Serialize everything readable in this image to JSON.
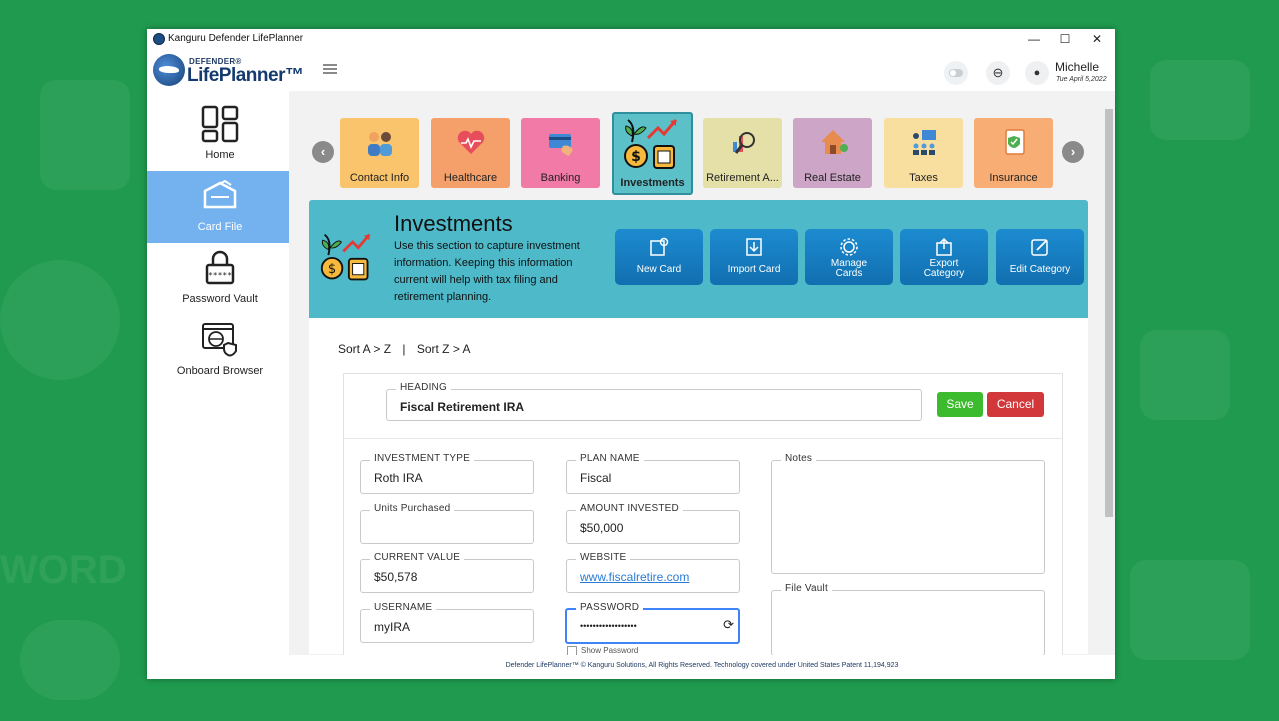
{
  "window": {
    "title": "Kanguru Defender LifePlanner",
    "controls": {
      "minimize": "—",
      "maximize": "☐",
      "close": "✕"
    }
  },
  "brand": {
    "top": "DEFENDER®",
    "main": "LifePlanner™"
  },
  "user": {
    "name": "Michelle",
    "date": "Tue April 5,2022"
  },
  "sidebar": {
    "items": [
      {
        "label": "Home",
        "icon": "grid-icon",
        "active": false
      },
      {
        "label": "Card File",
        "icon": "card-file-icon",
        "active": true
      },
      {
        "label": "Password Vault",
        "icon": "lock-icon",
        "active": false
      },
      {
        "label": "Onboard Browser",
        "icon": "browser-shield-icon",
        "active": false
      }
    ]
  },
  "categories": [
    {
      "label": "Contact Info",
      "color": "#f9c46b"
    },
    {
      "label": "Healthcare",
      "color": "#f5a06a"
    },
    {
      "label": "Banking",
      "color": "#f27aa6"
    },
    {
      "label": "Investments",
      "color": "#5bc0c7"
    },
    {
      "label": "Retirement A...",
      "color": "#e4e0a8"
    },
    {
      "label": "Real Estate",
      "color": "#cda5c6"
    },
    {
      "label": "Taxes",
      "color": "#f8df9f"
    },
    {
      "label": "Insurance",
      "color": "#f7ad74"
    }
  ],
  "section": {
    "title": "Investments",
    "description": "Use this section to capture investment information. Keeping this information current will help with tax filing and retirement planning."
  },
  "actions": [
    {
      "label": "New Card",
      "icon": "new-card-icon"
    },
    {
      "label": "Import Card",
      "icon": "import-icon"
    },
    {
      "label": "Manage Cards",
      "icon": "gear-icon"
    },
    {
      "label": "Export Category",
      "icon": "export-icon"
    },
    {
      "label": "Edit Category",
      "icon": "edit-icon"
    }
  ],
  "sort": {
    "az": "Sort A > Z",
    "sep": "|",
    "za": "Sort Z > A"
  },
  "form": {
    "heading_label": "HEADING",
    "heading_value": "Fiscal Retirement IRA",
    "save": "Save",
    "cancel": "Cancel",
    "investment_type_label": "INVESTMENT TYPE",
    "investment_type_value": "Roth IRA",
    "plan_name_label": "PLAN NAME",
    "plan_name_value": "Fiscal",
    "units_label": "Units Purchased",
    "units_value": "",
    "amount_label": "AMOUNT INVESTED",
    "amount_value": "$50,000",
    "current_value_label": "CURRENT VALUE",
    "current_value_value": "$50,578",
    "website_label": "WEBSITE",
    "website_value": "www.fiscalretire.com",
    "username_label": "USERNAME",
    "username_value": "myIRA",
    "password_label": "PASSWORD",
    "password_value": "••••••••••••••••••",
    "show_password": "Show Password",
    "notes_label": "Notes",
    "file_vault_label": "File Vault"
  },
  "footer": {
    "text": "Defender LifePlanner™ © Kanguru Solutions, All Rights Reserved. Technology covered under United States Patent 11,194,923"
  }
}
